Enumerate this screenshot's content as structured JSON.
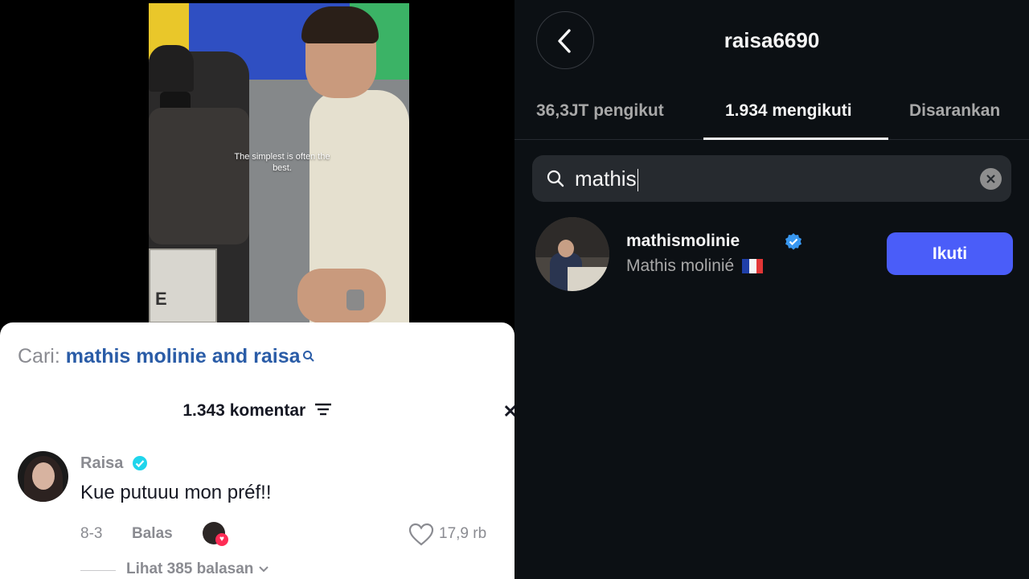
{
  "video": {
    "caption": "The simplest is often the best.",
    "cart_letter": "E"
  },
  "comments_panel": {
    "search_prefix": "Cari:",
    "search_query": "mathis molinie and raisa",
    "count_label": "1.343 komentar",
    "comment": {
      "author": "Raisa",
      "text": "Kue putuuu mon préf!!",
      "date": "8-3",
      "reply_label": "Balas",
      "likes": "17,9 rb"
    },
    "view_replies": "Lihat 385 balasan"
  },
  "profile": {
    "username": "raisa6690",
    "tabs": [
      {
        "label": "36,3JT pengikut"
      },
      {
        "label": "1.934 mengikuti"
      },
      {
        "label": "Disarankan"
      }
    ],
    "active_tab": 1,
    "search": {
      "value": "mathis"
    },
    "result": {
      "username": "mathismolinie",
      "full_name": "Mathis molinié",
      "follow_label": "Ikuti"
    }
  },
  "colors": {
    "accent_blue": "#4a5df9",
    "verified_blue": "#20d5ec",
    "link_blue": "#2a5ca7",
    "dark_bg": "#0c1014"
  },
  "icons": [
    "search-icon",
    "filter-icon",
    "verified-icon",
    "heart-icon",
    "chevron-down-icon",
    "back-arrow-icon",
    "clear-icon",
    "flag-fr-icon"
  ]
}
